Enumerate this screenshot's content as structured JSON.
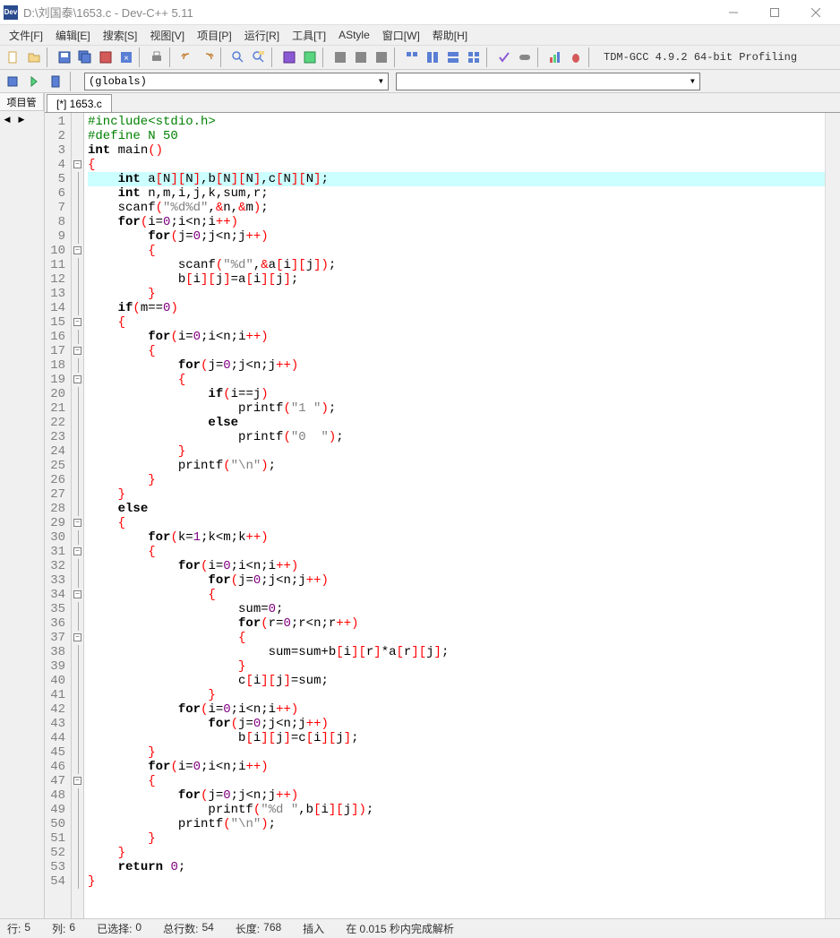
{
  "titlebar": {
    "icon_label": "Dev",
    "text": "D:\\刘国泰\\1653.c - Dev-C++ 5.11"
  },
  "menus": [
    "文件[F]",
    "编辑[E]",
    "搜索[S]",
    "视图[V]",
    "项目[P]",
    "运行[R]",
    "工具[T]",
    "AStyle",
    "窗口[W]",
    "帮助[H]"
  ],
  "compiler": "TDM-GCC 4.9.2 64-bit Profiling",
  "globals_combo": "(globals)",
  "sidebar_tab": "项目管",
  "file_tab": "[*] 1653.c",
  "status": {
    "line_lbl": "行:",
    "line_val": "5",
    "col_lbl": "列:",
    "col_val": "6",
    "sel_lbl": "已选择:",
    "sel_val": "0",
    "total_lbl": "总行数:",
    "total_val": "54",
    "len_lbl": "长度:",
    "len_val": "768",
    "mode": "插入",
    "parse": "在 0.015 秒内完成解析"
  },
  "code": [
    {
      "n": 1,
      "fold": "",
      "hl": false,
      "html": "<span class='pp'>#include&lt;stdio.h&gt;</span>"
    },
    {
      "n": 2,
      "fold": "",
      "hl": false,
      "html": "<span class='pp'>#define N 50</span>"
    },
    {
      "n": 3,
      "fold": "",
      "hl": false,
      "html": "<span class='kw'>int</span> main<span class='br'>()</span>"
    },
    {
      "n": 4,
      "fold": "box",
      "hl": false,
      "html": "<span class='br'>{</span>"
    },
    {
      "n": 5,
      "fold": "line",
      "hl": true,
      "html": "    <span class='kw'>int</span> a<span class='br'>[</span>N<span class='br'>][</span>N<span class='br'>]</span>,b<span class='br'>[</span>N<span class='br'>][</span>N<span class='br'>]</span>,c<span class='br'>[</span>N<span class='br'>][</span>N<span class='br'>]</span>;"
    },
    {
      "n": 6,
      "fold": "line",
      "hl": false,
      "html": "    <span class='kw'>int</span> n,m,i,j,k,sum,r;"
    },
    {
      "n": 7,
      "fold": "line",
      "hl": false,
      "html": "    scanf<span class='br'>(</span><span class='st'>\"%d%d\"</span>,<span class='br'>&amp;</span>n,<span class='br'>&amp;</span>m<span class='br'>)</span>;"
    },
    {
      "n": 8,
      "fold": "line",
      "hl": false,
      "html": "    <span class='kw'>for</span><span class='br'>(</span>i=<span class='nm'>0</span>;i&lt;n;i<span class='br'>++)</span>"
    },
    {
      "n": 9,
      "fold": "line",
      "hl": false,
      "html": "        <span class='kw'>for</span><span class='br'>(</span>j=<span class='nm'>0</span>;j&lt;n;j<span class='br'>++)</span>"
    },
    {
      "n": 10,
      "fold": "box",
      "hl": false,
      "html": "        <span class='br'>{</span>"
    },
    {
      "n": 11,
      "fold": "line",
      "hl": false,
      "html": "            scanf<span class='br'>(</span><span class='st'>\"%d\"</span>,<span class='br'>&amp;</span>a<span class='br'>[</span>i<span class='br'>][</span>j<span class='br'>])</span>;"
    },
    {
      "n": 12,
      "fold": "line",
      "hl": false,
      "html": "            b<span class='br'>[</span>i<span class='br'>][</span>j<span class='br'>]</span>=a<span class='br'>[</span>i<span class='br'>][</span>j<span class='br'>]</span>;"
    },
    {
      "n": 13,
      "fold": "line",
      "hl": false,
      "html": "        <span class='br'>}</span>"
    },
    {
      "n": 14,
      "fold": "line",
      "hl": false,
      "html": "    <span class='kw'>if</span><span class='br'>(</span>m==<span class='nm'>0</span><span class='br'>)</span>"
    },
    {
      "n": 15,
      "fold": "box",
      "hl": false,
      "html": "    <span class='br'>{</span>"
    },
    {
      "n": 16,
      "fold": "line",
      "hl": false,
      "html": "        <span class='kw'>for</span><span class='br'>(</span>i=<span class='nm'>0</span>;i&lt;n;i<span class='br'>++)</span>"
    },
    {
      "n": 17,
      "fold": "box",
      "hl": false,
      "html": "        <span class='br'>{</span>"
    },
    {
      "n": 18,
      "fold": "line",
      "hl": false,
      "html": "            <span class='kw'>for</span><span class='br'>(</span>j=<span class='nm'>0</span>;j&lt;n;j<span class='br'>++)</span>"
    },
    {
      "n": 19,
      "fold": "box",
      "hl": false,
      "html": "            <span class='br'>{</span>"
    },
    {
      "n": 20,
      "fold": "line",
      "hl": false,
      "html": "                <span class='kw'>if</span><span class='br'>(</span>i==j<span class='br'>)</span>"
    },
    {
      "n": 21,
      "fold": "line",
      "hl": false,
      "html": "                    printf<span class='br'>(</span><span class='st'>\"1 \"</span><span class='br'>)</span>;"
    },
    {
      "n": 22,
      "fold": "line",
      "hl": false,
      "html": "                <span class='kw'>else</span>"
    },
    {
      "n": 23,
      "fold": "line",
      "hl": false,
      "html": "                    printf<span class='br'>(</span><span class='st'>\"0  \"</span><span class='br'>)</span>;"
    },
    {
      "n": 24,
      "fold": "line",
      "hl": false,
      "html": "            <span class='br'>}</span>"
    },
    {
      "n": 25,
      "fold": "line",
      "hl": false,
      "html": "            printf<span class='br'>(</span><span class='st'>\"\\n\"</span><span class='br'>)</span>;"
    },
    {
      "n": 26,
      "fold": "line",
      "hl": false,
      "html": "        <span class='br'>}</span>"
    },
    {
      "n": 27,
      "fold": "line",
      "hl": false,
      "html": "    <span class='br'>}</span>"
    },
    {
      "n": 28,
      "fold": "line",
      "hl": false,
      "html": "    <span class='kw'>else</span>"
    },
    {
      "n": 29,
      "fold": "box",
      "hl": false,
      "html": "    <span class='br'>{</span>"
    },
    {
      "n": 30,
      "fold": "line",
      "hl": false,
      "html": "        <span class='kw'>for</span><span class='br'>(</span>k=<span class='nm'>1</span>;k&lt;m;k<span class='br'>++)</span>"
    },
    {
      "n": 31,
      "fold": "box",
      "hl": false,
      "html": "        <span class='br'>{</span>"
    },
    {
      "n": 32,
      "fold": "line",
      "hl": false,
      "html": "            <span class='kw'>for</span><span class='br'>(</span>i=<span class='nm'>0</span>;i&lt;n;i<span class='br'>++)</span>"
    },
    {
      "n": 33,
      "fold": "line",
      "hl": false,
      "html": "                <span class='kw'>for</span><span class='br'>(</span>j=<span class='nm'>0</span>;j&lt;n;j<span class='br'>++)</span>"
    },
    {
      "n": 34,
      "fold": "box",
      "hl": false,
      "html": "                <span class='br'>{</span>"
    },
    {
      "n": 35,
      "fold": "line",
      "hl": false,
      "html": "                    sum=<span class='nm'>0</span>;"
    },
    {
      "n": 36,
      "fold": "line",
      "hl": false,
      "html": "                    <span class='kw'>for</span><span class='br'>(</span>r=<span class='nm'>0</span>;r&lt;n;r<span class='br'>++)</span>"
    },
    {
      "n": 37,
      "fold": "box",
      "hl": false,
      "html": "                    <span class='br'>{</span>"
    },
    {
      "n": 38,
      "fold": "line",
      "hl": false,
      "html": "                        sum=sum+b<span class='br'>[</span>i<span class='br'>][</span>r<span class='br'>]</span>*a<span class='br'>[</span>r<span class='br'>][</span>j<span class='br'>]</span>;"
    },
    {
      "n": 39,
      "fold": "line",
      "hl": false,
      "html": "                    <span class='br'>}</span>"
    },
    {
      "n": 40,
      "fold": "line",
      "hl": false,
      "html": "                    c<span class='br'>[</span>i<span class='br'>][</span>j<span class='br'>]</span>=sum;"
    },
    {
      "n": 41,
      "fold": "line",
      "hl": false,
      "html": "                <span class='br'>}</span>"
    },
    {
      "n": 42,
      "fold": "line",
      "hl": false,
      "html": "            <span class='kw'>for</span><span class='br'>(</span>i=<span class='nm'>0</span>;i&lt;n;i<span class='br'>++)</span>"
    },
    {
      "n": 43,
      "fold": "line",
      "hl": false,
      "html": "                <span class='kw'>for</span><span class='br'>(</span>j=<span class='nm'>0</span>;j&lt;n;j<span class='br'>++)</span>"
    },
    {
      "n": 44,
      "fold": "line",
      "hl": false,
      "html": "                    b<span class='br'>[</span>i<span class='br'>][</span>j<span class='br'>]</span>=c<span class='br'>[</span>i<span class='br'>][</span>j<span class='br'>]</span>;"
    },
    {
      "n": 45,
      "fold": "line",
      "hl": false,
      "html": "        <span class='br'>}</span>"
    },
    {
      "n": 46,
      "fold": "line",
      "hl": false,
      "html": "        <span class='kw'>for</span><span class='br'>(</span>i=<span class='nm'>0</span>;i&lt;n;i<span class='br'>++)</span>"
    },
    {
      "n": 47,
      "fold": "box",
      "hl": false,
      "html": "        <span class='br'>{</span>"
    },
    {
      "n": 48,
      "fold": "line",
      "hl": false,
      "html": "            <span class='kw'>for</span><span class='br'>(</span>j=<span class='nm'>0</span>;j&lt;n;j<span class='br'>++)</span>"
    },
    {
      "n": 49,
      "fold": "line",
      "hl": false,
      "html": "                printf<span class='br'>(</span><span class='st'>\"%d \"</span>,b<span class='br'>[</span>i<span class='br'>][</span>j<span class='br'>])</span>;"
    },
    {
      "n": 50,
      "fold": "line",
      "hl": false,
      "html": "            printf<span class='br'>(</span><span class='st'>\"\\n\"</span><span class='br'>)</span>;"
    },
    {
      "n": 51,
      "fold": "line",
      "hl": false,
      "html": "        <span class='br'>}</span>"
    },
    {
      "n": 52,
      "fold": "line",
      "hl": false,
      "html": "    <span class='br'>}</span>"
    },
    {
      "n": 53,
      "fold": "line",
      "hl": false,
      "html": "    <span class='kw'>return</span> <span class='nm'>0</span>;"
    },
    {
      "n": 54,
      "fold": "line",
      "hl": false,
      "html": "<span class='br'>}</span>"
    }
  ]
}
